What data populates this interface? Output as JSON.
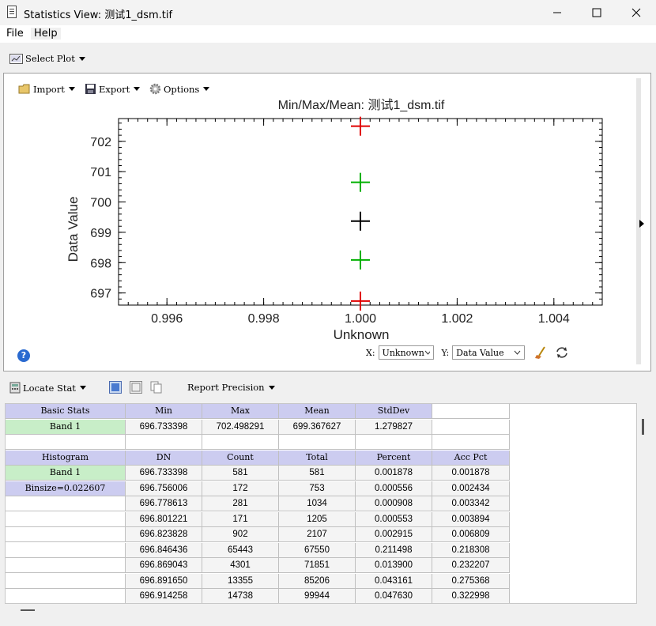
{
  "window": {
    "title": "Statistics View: 测试1_dsm.tif"
  },
  "menu": {
    "file": "File",
    "help": "Help"
  },
  "toolbar": {
    "select_plot": "Select Plot"
  },
  "plot_toolbar": {
    "import": "Import",
    "export": "Export",
    "options": "Options"
  },
  "plot_axes_selector": {
    "x_label": "X:",
    "x_value": "Unknown",
    "y_label": "Y:",
    "y_value": "Data Value"
  },
  "chart_data": {
    "type": "scatter",
    "title": "Min/Max/Mean: 测试1_dsm.tif",
    "xlabel": "Unknown",
    "ylabel": "Data Value",
    "xlim": [
      0.995,
      1.005
    ],
    "ylim": [
      696.6,
      702.75
    ],
    "x_ticks": [
      "0.996",
      "0.998",
      "1.000",
      "1.002",
      "1.004"
    ],
    "y_ticks": [
      "697",
      "698",
      "699",
      "700",
      "701",
      "702"
    ],
    "series": [
      {
        "color": "#e00000",
        "points": [
          [
            1.0,
            702.498291
          ],
          [
            1.0,
            696.733398
          ]
        ]
      },
      {
        "color": "#00b000",
        "points": [
          [
            1.0,
            700.647454
          ],
          [
            1.0,
            698.0878
          ]
        ]
      },
      {
        "color": "#000000",
        "points": [
          [
            1.0,
            699.367627
          ]
        ]
      }
    ],
    "grid": false
  },
  "bottom_toolbar": {
    "locate_stat": "Locate Stat",
    "report_precision": "Report Precision"
  },
  "stats": {
    "basic_headers": [
      "Basic Stats",
      "Min",
      "Max",
      "Mean",
      "StdDev"
    ],
    "basic_row": [
      "Band 1",
      "696.733398",
      "702.498291",
      "699.367627",
      "1.279827"
    ],
    "hist_headers": [
      "Histogram",
      "DN",
      "Count",
      "Total",
      "Percent",
      "Acc Pct"
    ],
    "hist_label_band": "Band 1",
    "hist_label_binsize": "Binsize=0.022607",
    "hist_rows": [
      [
        "696.733398",
        "581",
        "581",
        "0.001878",
        "0.001878"
      ],
      [
        "696.756006",
        "172",
        "753",
        "0.000556",
        "0.002434"
      ],
      [
        "696.778613",
        "281",
        "1034",
        "0.000908",
        "0.003342"
      ],
      [
        "696.801221",
        "171",
        "1205",
        "0.000553",
        "0.003894"
      ],
      [
        "696.823828",
        "902",
        "2107",
        "0.002915",
        "0.006809"
      ],
      [
        "696.846436",
        "65443",
        "67550",
        "0.211498",
        "0.218308"
      ],
      [
        "696.869043",
        "4301",
        "71851",
        "0.013900",
        "0.232207"
      ],
      [
        "696.891650",
        "13355",
        "85206",
        "0.043161",
        "0.275368"
      ],
      [
        "696.914258",
        "14738",
        "99944",
        "0.047630",
        "0.322998"
      ]
    ]
  }
}
